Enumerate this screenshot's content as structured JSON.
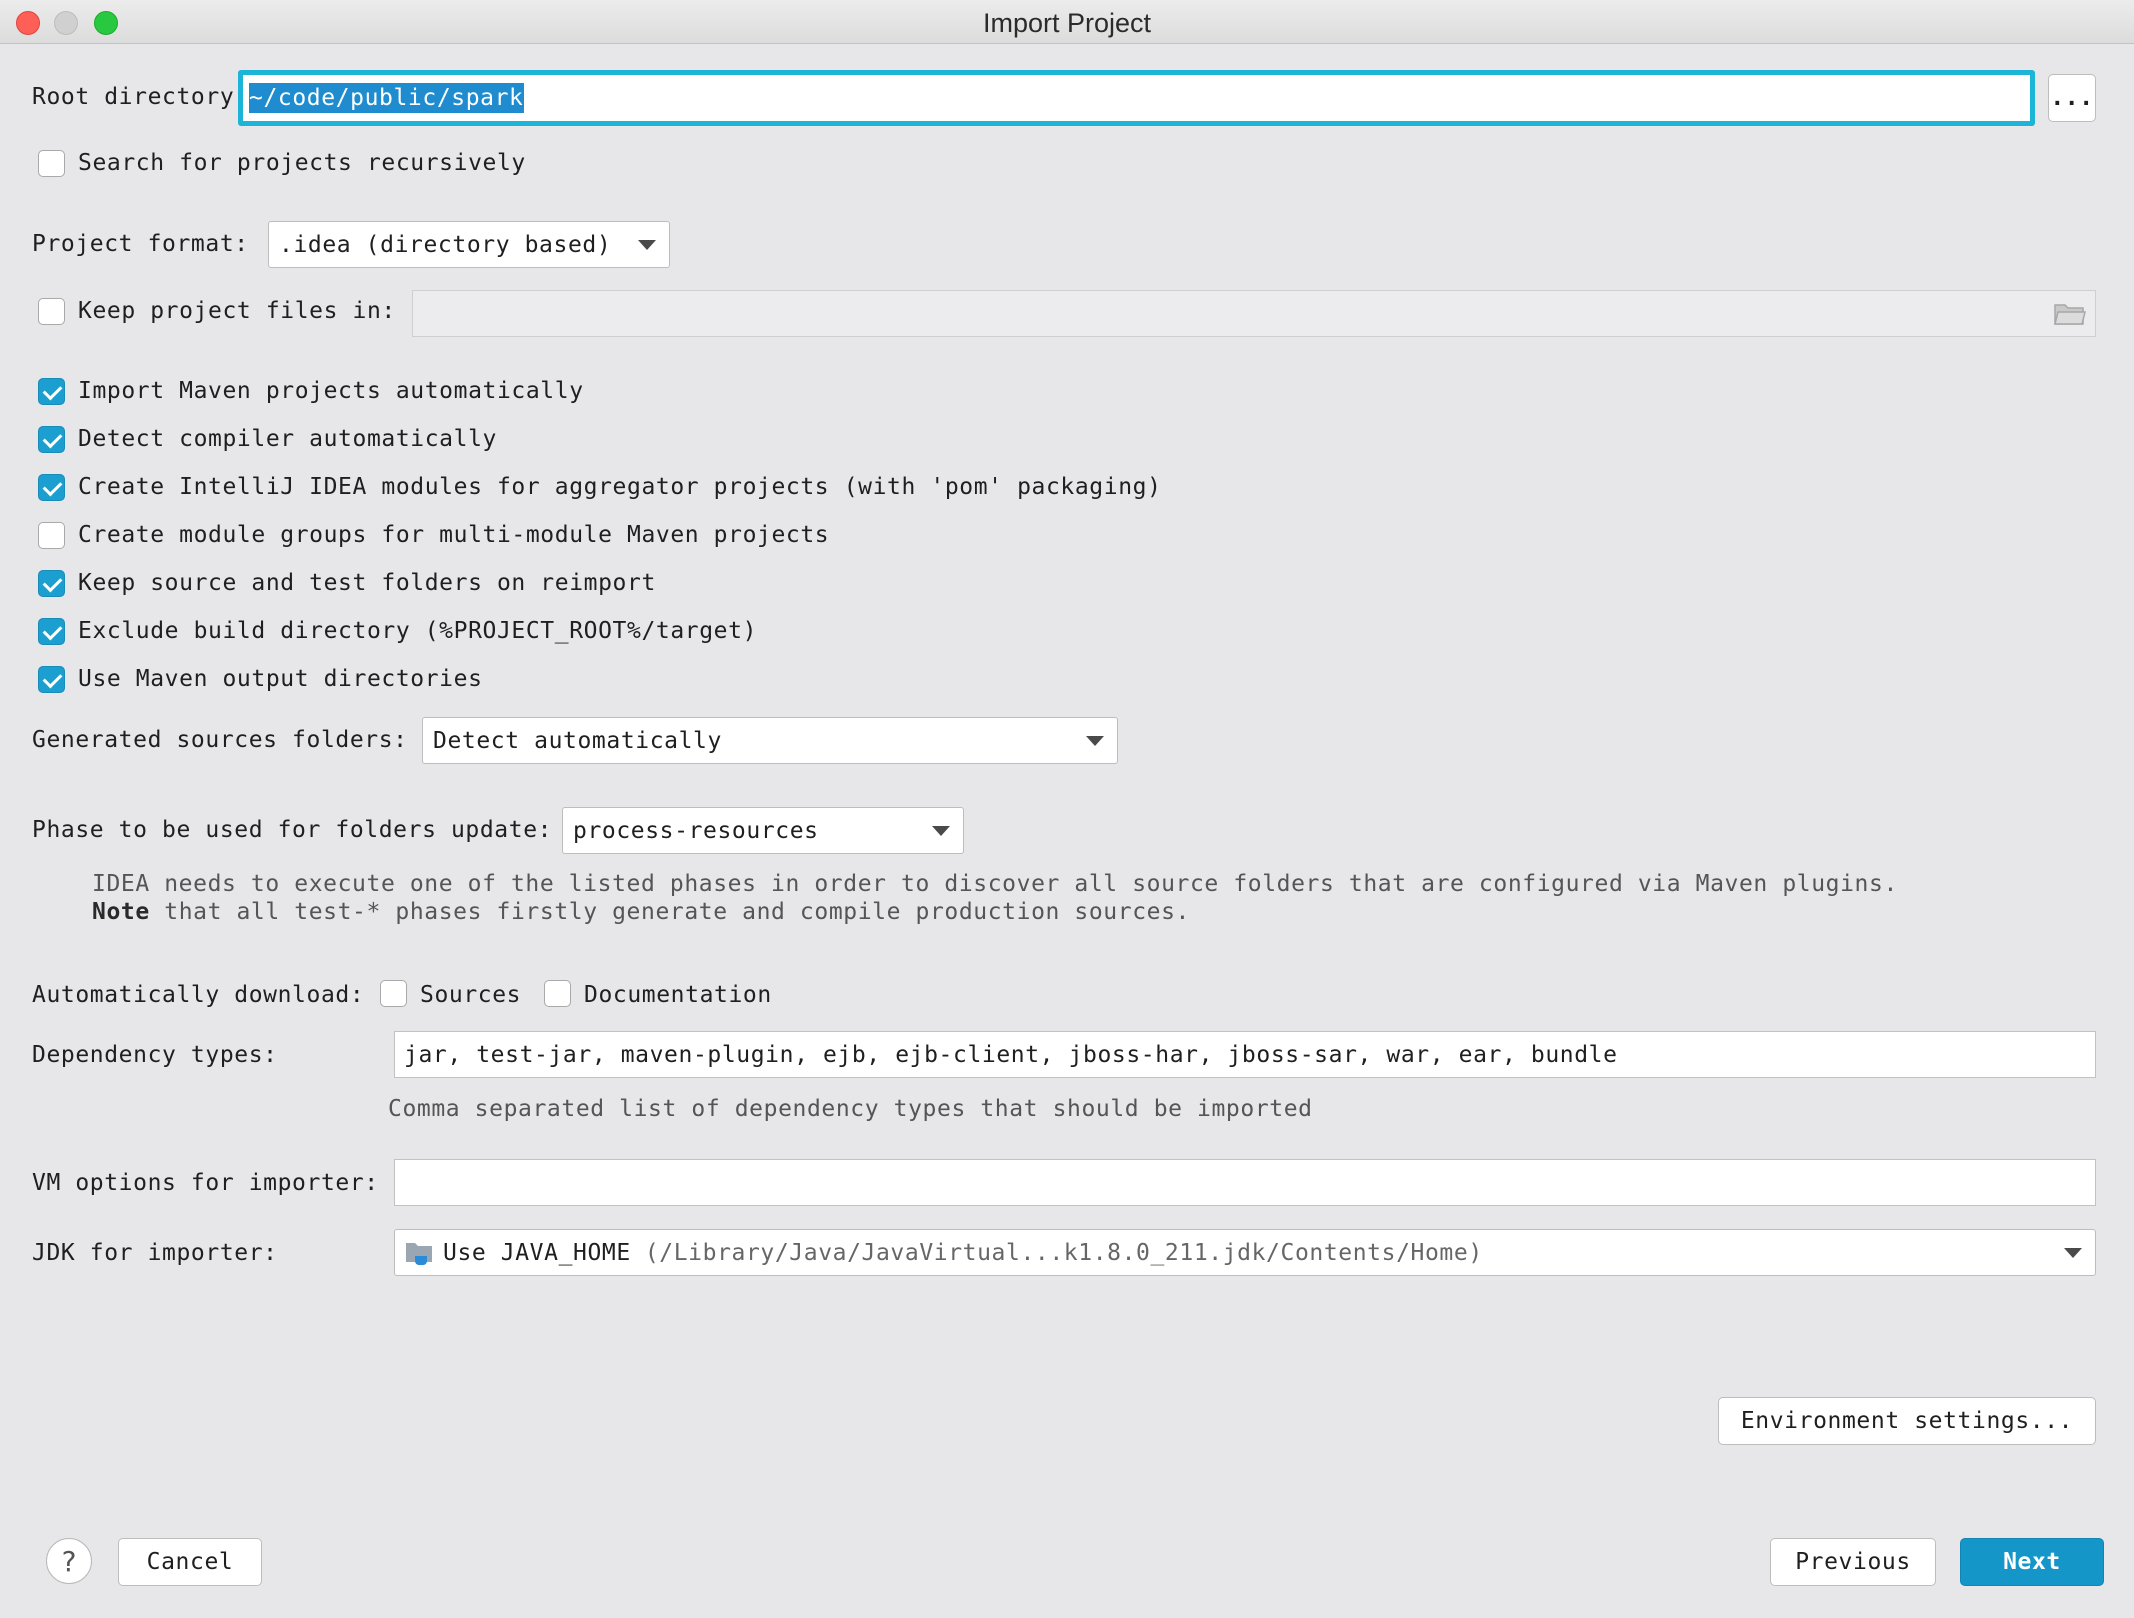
{
  "window": {
    "title": "Import Project"
  },
  "root": {
    "label": "Root directory",
    "value": "~/code/public/spark",
    "browse_label": "..."
  },
  "search_recursive": {
    "label": "Search for projects recursively",
    "checked": false
  },
  "project_format": {
    "label": "Project format:",
    "value": ".idea (directory based)"
  },
  "keep_files": {
    "label": "Keep project files in:",
    "checked": false,
    "value": ""
  },
  "options": [
    {
      "label": "Import Maven projects automatically",
      "checked": true
    },
    {
      "label": "Detect compiler automatically",
      "checked": true
    },
    {
      "label": "Create IntelliJ IDEA modules for aggregator projects (with 'pom' packaging)",
      "checked": true
    },
    {
      "label": "Create module groups for multi-module Maven projects",
      "checked": false
    },
    {
      "label": "Keep source and test folders on reimport",
      "checked": true
    },
    {
      "label": "Exclude build directory (%PROJECT_ROOT%/target)",
      "checked": true
    },
    {
      "label": "Use Maven output directories",
      "checked": true
    }
  ],
  "generated_sources": {
    "label": "Generated sources folders:",
    "value": "Detect automatically"
  },
  "phase": {
    "label": "Phase to be used for folders update:",
    "value": "process-resources",
    "hint_line1": "IDEA needs to execute one of the listed phases in order to discover all source folders that are configured via Maven plugins.",
    "hint_note_bold": "Note",
    "hint_line2_rest": " that all test-* phases firstly generate and compile production sources."
  },
  "auto_download": {
    "label": "Automatically download:",
    "sources_label": "Sources",
    "sources_checked": false,
    "docs_label": "Documentation",
    "docs_checked": false
  },
  "dependency_types": {
    "label": "Dependency types:",
    "value": "jar, test-jar, maven-plugin, ejb, ejb-client, jboss-har, jboss-sar, war, ear, bundle",
    "hint": "Comma separated list of dependency types that should be imported"
  },
  "vm_options": {
    "label": "VM options for importer:",
    "value": ""
  },
  "jdk": {
    "label": "JDK for importer:",
    "value_main": "Use JAVA_HOME",
    "value_path": "(/Library/Java/JavaVirtual...k1.8.0_211.jdk/Contents/Home)"
  },
  "buttons": {
    "env_settings": "Environment settings...",
    "help": "?",
    "cancel": "Cancel",
    "previous": "Previous",
    "next": "Next"
  },
  "colors": {
    "accent": "#1596c9",
    "focus_ring": "#1cb5d8",
    "checkbox_checked": "#1b9fd0"
  }
}
